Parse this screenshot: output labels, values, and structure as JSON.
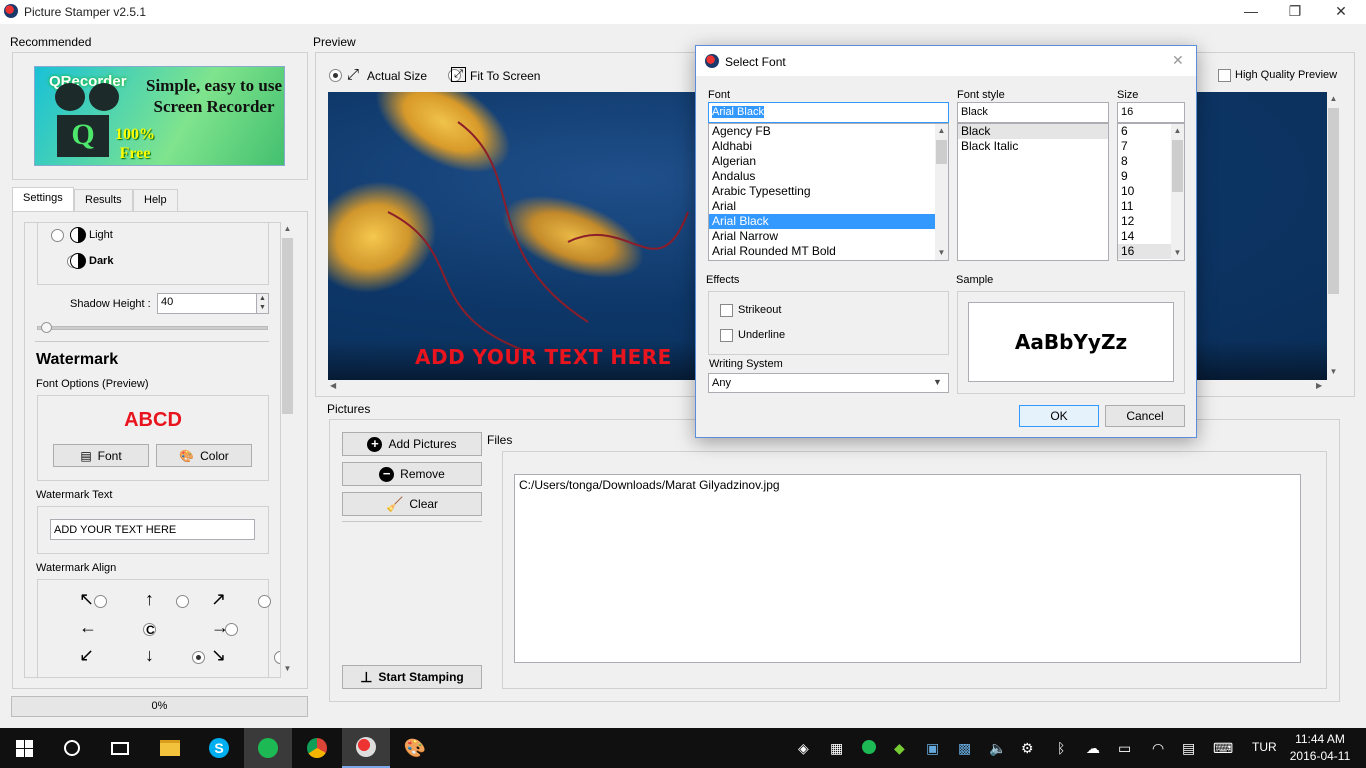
{
  "window": {
    "title": "Picture Stamper v2.5.1",
    "minimize": "—",
    "maximize": "❐",
    "close": "✕"
  },
  "recommended": {
    "label": "Recommended",
    "ad_logo_text": "QRecorder",
    "ad_text": "Simple, easy to use Screen Recorder",
    "ad_badge": "100% Free"
  },
  "tabs": [
    "Settings",
    "Results",
    "Help"
  ],
  "settings": {
    "theme_light": "Light",
    "theme_dark": "Dark",
    "shadow_height_label": "Shadow Height :",
    "shadow_height_value": "40",
    "watermark_title": "Watermark",
    "font_options_label": "Font Options (Preview)",
    "font_preview_text": "ABCD",
    "font_button": "Font",
    "color_button": "Color",
    "watermark_text_label": "Watermark Text",
    "watermark_text_value": "ADD YOUR TEXT HERE",
    "watermark_align_label": "Watermark Align",
    "align_center": "C",
    "align_symbols": [
      "↖",
      "↑",
      "↗",
      "←",
      "C",
      "→",
      "↙",
      "↓",
      "↘"
    ],
    "align_selected": "bottom-left"
  },
  "progress": {
    "text": "0%",
    "value": 0
  },
  "preview": {
    "label": "Preview",
    "actual_size": "Actual Size",
    "fit_to_screen": "Fit To Screen",
    "high_quality": "High Quality Preview",
    "overlay_text": "ADD YOUR TEXT HERE"
  },
  "pictures": {
    "label": "Pictures",
    "add_button": "Add Pictures",
    "remove_button": "Remove",
    "clear_button": "Clear",
    "files_label": "Files",
    "files": [
      "C:/Users/tonga/Downloads/Marat Gilyadzinov.jpg"
    ],
    "start_button": "Start Stamping"
  },
  "dialog": {
    "title": "Select Font",
    "font_label": "Font",
    "font_value": "Arial Black",
    "fonts": [
      "Agency FB",
      "Aldhabi",
      "Algerian",
      "Andalus",
      "Arabic Typesetting",
      "Arial",
      "Arial Black",
      "Arial Narrow",
      "Arial Rounded MT Bold"
    ],
    "style_label": "Font style",
    "style_value": "Black",
    "styles": [
      "Black",
      "Black Italic"
    ],
    "size_label": "Size",
    "size_value": "16",
    "sizes": [
      "6",
      "7",
      "8",
      "9",
      "10",
      "11",
      "12",
      "14",
      "16"
    ],
    "effects_label": "Effects",
    "strikeout": "Strikeout",
    "underline": "Underline",
    "writing_system_label": "Writing System",
    "writing_system_value": "Any",
    "sample_label": "Sample",
    "sample_text": "AaBbYyZz",
    "ok": "OK",
    "cancel": "Cancel"
  },
  "taskbar": {
    "lang": "TUR",
    "time": "11:44 AM",
    "date": "2016-04-11"
  },
  "colors": {
    "accent": "#3399ff",
    "watermark_red": "#e8141e",
    "dialog_border": "#5a8ed8"
  }
}
